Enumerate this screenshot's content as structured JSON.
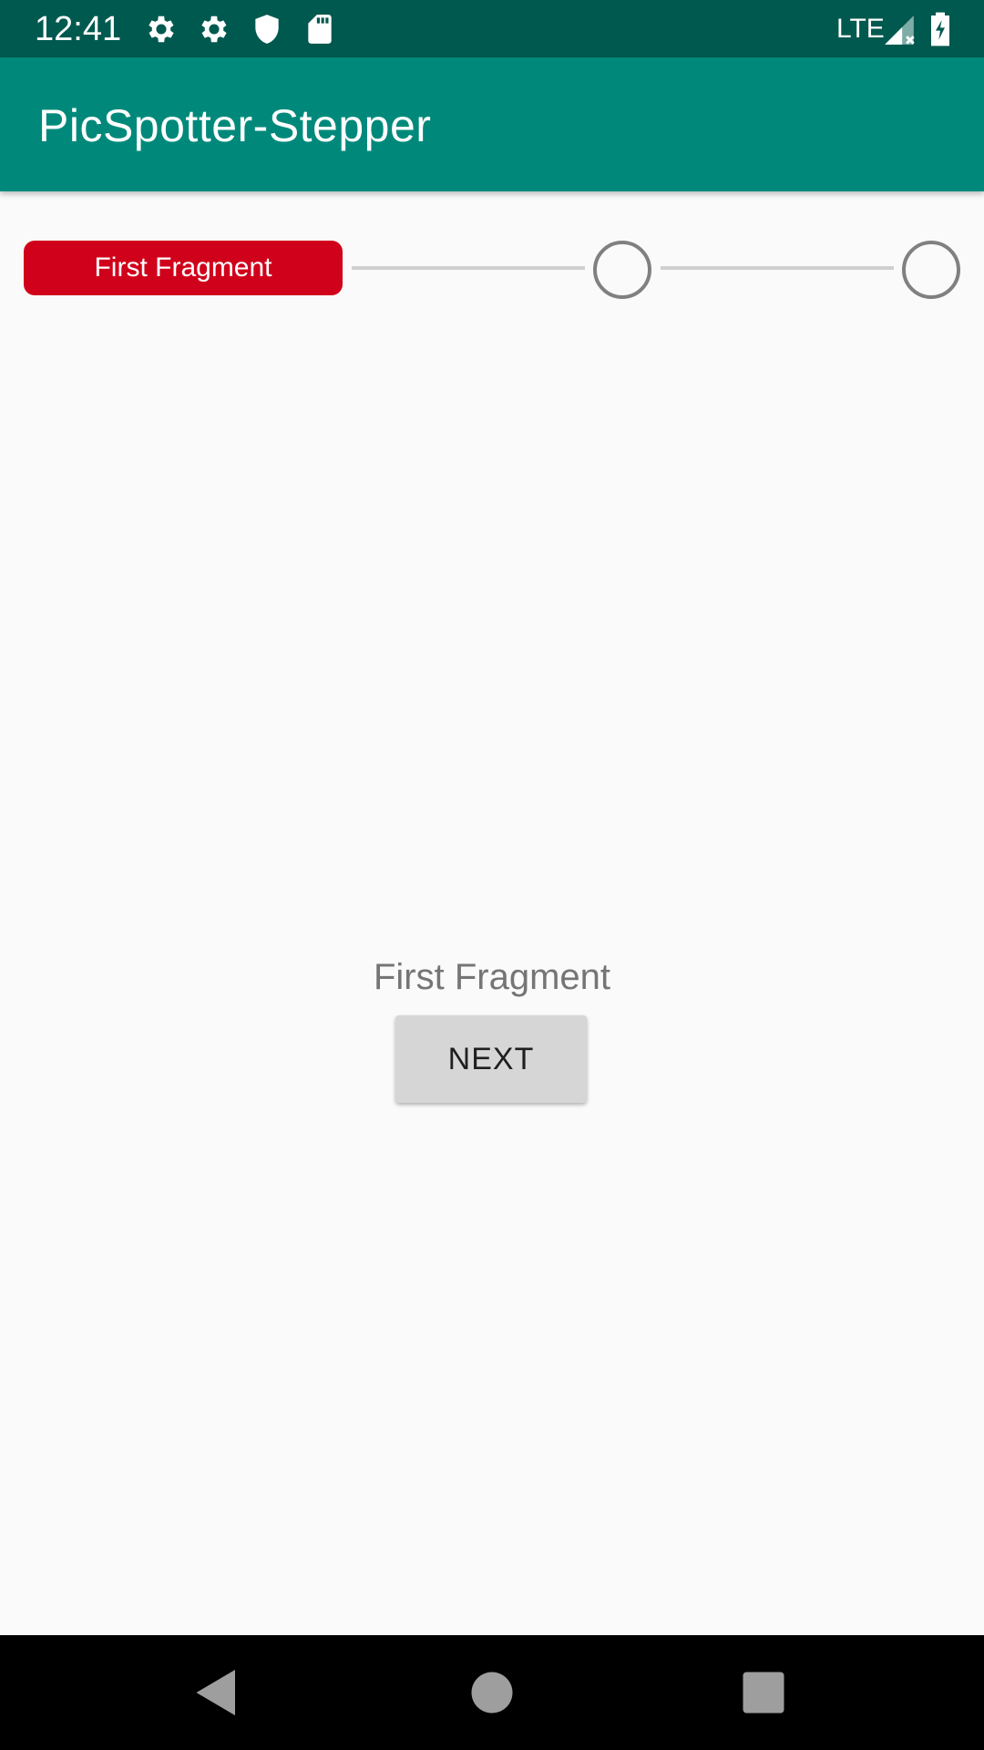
{
  "status_bar": {
    "time": "12:41",
    "network": "LTE",
    "icons": [
      "settings-icon",
      "settings-icon",
      "shield-icon",
      "sd-card-icon",
      "signal-icon",
      "battery-charging-icon"
    ]
  },
  "app_bar": {
    "title": "PicSpotter-Stepper",
    "color": "#00897b"
  },
  "stepper": {
    "steps": [
      {
        "label": "First Fragment",
        "state": "active"
      },
      {
        "label": "",
        "state": "inactive"
      },
      {
        "label": "",
        "state": "inactive"
      }
    ],
    "active_color": "#d0021b"
  },
  "content": {
    "fragment_text": "First Fragment",
    "next_button_label": "NEXT"
  },
  "nav_bar": {
    "buttons": [
      "back-icon",
      "home-icon",
      "recents-icon"
    ]
  }
}
